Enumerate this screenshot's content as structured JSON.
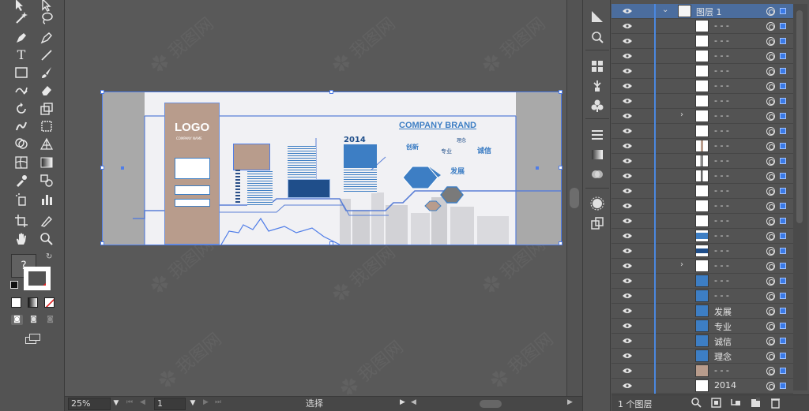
{
  "status_bar": {
    "zoom": "25%",
    "page": "1",
    "mode": "选择"
  },
  "artwork": {
    "logo": "LOGO",
    "logo_sub": "COMPANY NAME",
    "company_brand": "COMPANY BRAND",
    "year": "2014",
    "words": [
      "创新",
      "专业",
      "理念",
      "诚信",
      "发展"
    ],
    "accent": "#3d7ec4",
    "brown": "#b89c8c"
  },
  "layers_panel": {
    "top_layer": "图层 1",
    "footer_count": "1 个图层",
    "rows": [
      {
        "name": "- - -"
      },
      {
        "name": "- - -"
      },
      {
        "name": "- - -"
      },
      {
        "name": "- - -"
      },
      {
        "name": "- - -"
      },
      {
        "name": "- - -"
      },
      {
        "name": "- - -",
        "expandable": true
      },
      {
        "name": "- - -"
      },
      {
        "name": "- - -"
      },
      {
        "name": "- - -"
      },
      {
        "name": "- - -"
      },
      {
        "name": "- - -"
      },
      {
        "name": "- - -"
      },
      {
        "name": "- - -"
      },
      {
        "name": "- - -"
      },
      {
        "name": "- - -"
      },
      {
        "name": "- - -",
        "expandable": true
      },
      {
        "name": "- - -"
      },
      {
        "name": "- - -"
      },
      {
        "name": "发展"
      },
      {
        "name": "专业"
      },
      {
        "name": "诚信"
      },
      {
        "name": "理念"
      },
      {
        "name": "- - -"
      },
      {
        "name": "2014"
      }
    ]
  }
}
